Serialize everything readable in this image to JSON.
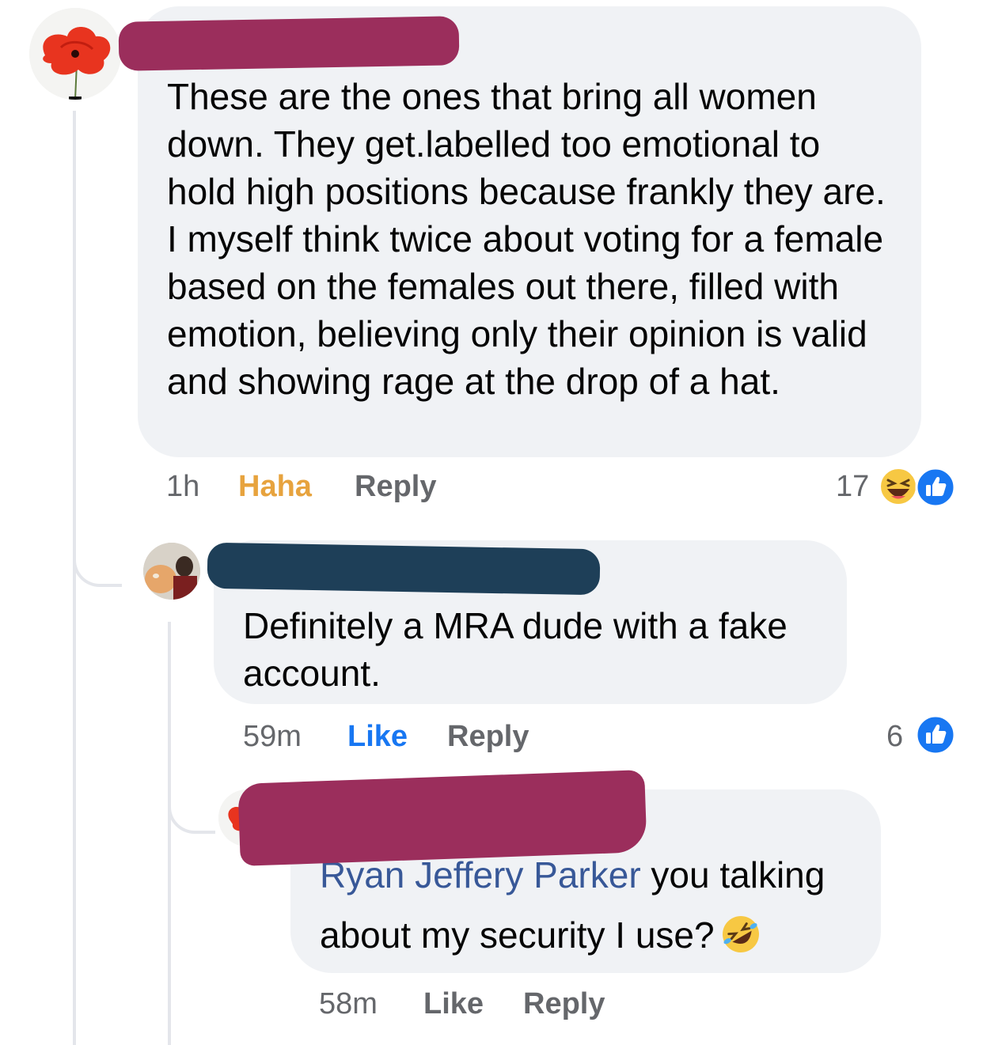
{
  "comments": [
    {
      "text": "These are the ones that bring all women down. They get.labelled too emotional to hold high positions because frankly they are.  I myself think twice about voting for a female based on the females out there, filled with emotion, believing only their opinion is valid and showing rage at the drop of a hat.",
      "time": "1h",
      "reaction_label": "Haha",
      "reply_label": "Reply",
      "reaction_count": "17",
      "reaction_icons": [
        "haha-icon",
        "like-icon"
      ]
    },
    {
      "text": "Definitely a MRA dude with a fake account.",
      "time": "59m",
      "reaction_label": "Like",
      "reply_label": "Reply",
      "reaction_count": "6",
      "reaction_icons": [
        "like-icon"
      ]
    },
    {
      "mention": "Ryan Jeffery Parker",
      "text": " you talking about my security I use?",
      "emoji": "rolling-on-floor-laughing-icon",
      "time": "58m",
      "reaction_label": "Like",
      "reply_label": "Reply"
    }
  ],
  "colors": {
    "bubble": "#f0f2f5",
    "meta_text": "#65676b",
    "haha_active": "#e7a33e",
    "like_active": "#1877f2",
    "mention": "#385898",
    "redaction_pink": "#9b2e5c",
    "redaction_navy": "#1e3f58"
  }
}
